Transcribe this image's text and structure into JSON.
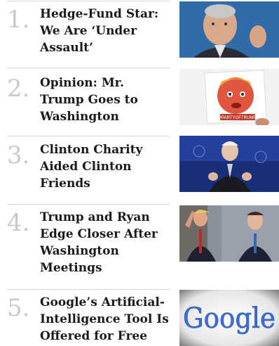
{
  "stories": [
    {
      "rank": "1.",
      "headline": "Hedge-Fund Star: We Are ‘Under Assault’",
      "image_icon": "photo-hedge-fund-star"
    },
    {
      "rank": "2.",
      "headline": "Opinion: Mr. Trump Goes to Washington",
      "image_icon": "photo-trump-caricature-sign",
      "sign_text": "#PARTYOFTRUMP"
    },
    {
      "rank": "3.",
      "headline": "Clinton Charity Aided Clinton Friends",
      "image_icon": "photo-clinton-speaking"
    },
    {
      "rank": "4.",
      "headline": "Trump and Ryan Edge Closer After Washington Meetings",
      "image_icon": "photo-trump-and-ryan"
    },
    {
      "rank": "5.",
      "headline": "Google’s Artificial-Intelligence Tool Is Offered for Free",
      "image_icon": "photo-google-logo",
      "logo_text": "Google"
    }
  ]
}
